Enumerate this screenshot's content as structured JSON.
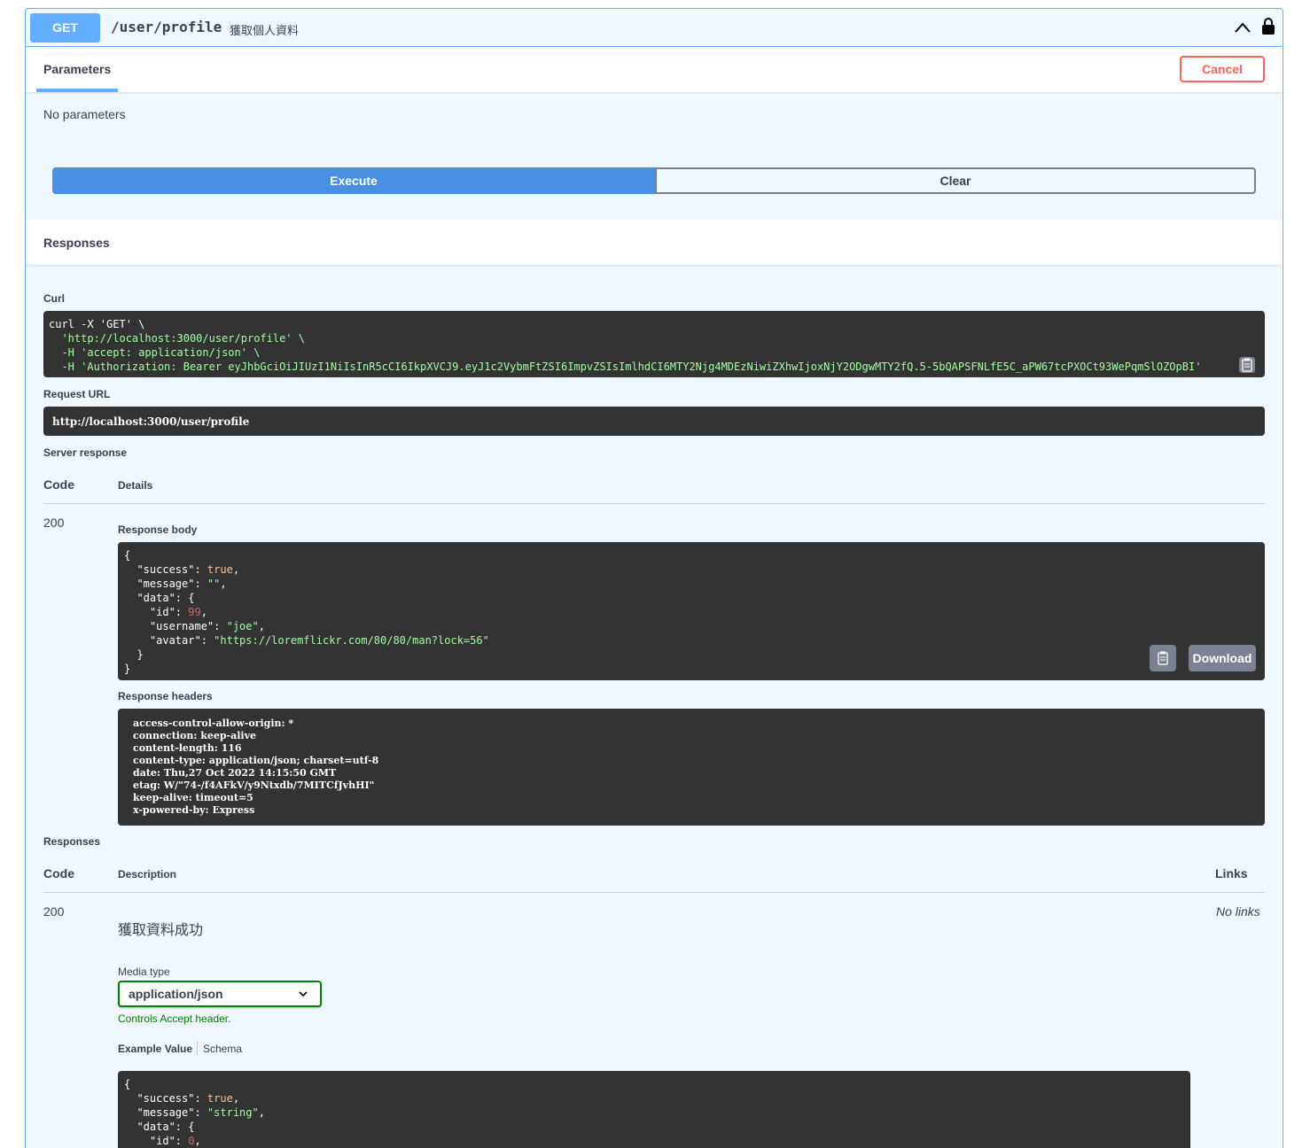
{
  "operation": {
    "method": "GET",
    "path": "/user/profile",
    "summary": "獲取個人資料"
  },
  "parameters": {
    "tab_label": "Parameters",
    "cancel_label": "Cancel",
    "empty_text": "No parameters"
  },
  "actions": {
    "execute_label": "Execute",
    "clear_label": "Clear"
  },
  "responses_section": {
    "title": "Responses"
  },
  "live": {
    "curl_label": "Curl",
    "curl_lines": [
      "curl -X 'GET' \\",
      "  'http://localhost:3000/user/profile' \\",
      "  -H 'accept: application/json' \\",
      "  -H 'Authorization: Bearer eyJhbGciOiJIUzI1NiIsInR5cCI6IkpXVCJ9.eyJ1c2VybmFtZSI6ImpvZSIsImlhdCI6MTY2Njg4MDEzNiwiZXhwIjoxNjY2ODgwMTY2fQ.5-5bQAPSFNLfE5C_aPW67tcPXOCt93WePqmSlOZOpBI'"
    ],
    "request_url_label": "Request URL",
    "request_url": "http://localhost:3000/user/profile",
    "server_response_label": "Server response",
    "code_header": "Code",
    "details_header": "Details",
    "status_code": "200",
    "response_body_label": "Response body",
    "download_label": "Download",
    "response_headers_label": "Response headers",
    "response_headers": [
      "access-control-allow-origin: *",
      "connection: keep-alive",
      "content-length: 116",
      "content-type: application/json; charset=utf-8",
      "date: Thu,27 Oct 2022 14:15:50 GMT",
      "etag: W/\"74-/f4AFkV/y9Ntxdb/7MITCfJvhHI\"",
      "keep-alive: timeout=5",
      "x-powered-by: Express"
    ],
    "body": {
      "success": "true",
      "message": "\"\"",
      "id": "99",
      "username": "\"joe\"",
      "avatar": "\"https://loremflickr.com/80/80/man?lock=56\""
    }
  },
  "documented": {
    "title": "Responses",
    "code_header": "Code",
    "description_header": "Description",
    "links_header": "Links",
    "status_code": "200",
    "description": "獲取資料成功",
    "no_links": "No links",
    "media_type_label": "Media type",
    "media_type_value": "application/json",
    "controls_hint": "Controls Accept header.",
    "example_value_tab": "Example Value",
    "schema_tab": "Schema",
    "example": {
      "success": "true",
      "message": "\"string\"",
      "id": "0"
    }
  },
  "colors": {
    "get_accent": "#61affe",
    "execute": "#4990e2",
    "cancel": "#ff6060",
    "code_bg": "#333333",
    "string": "#a2fca2",
    "number": "#d36363",
    "boolean": "#fcc28c"
  },
  "icons": [
    "chevron-up-icon",
    "lock-icon",
    "copy-icon"
  ]
}
